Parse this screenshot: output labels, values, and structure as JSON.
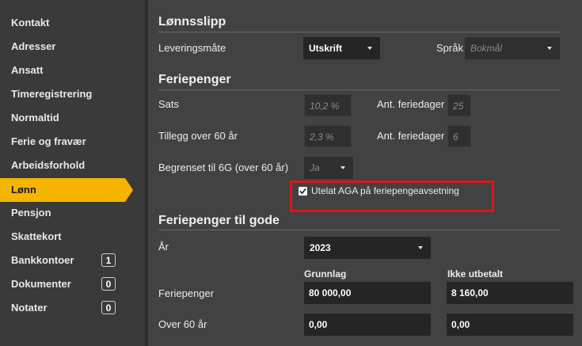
{
  "sidebar": {
    "items": [
      {
        "label": "Kontakt"
      },
      {
        "label": "Adresser"
      },
      {
        "label": "Ansatt"
      },
      {
        "label": "Timeregistrering"
      },
      {
        "label": "Normaltid"
      },
      {
        "label": "Ferie og fravær"
      },
      {
        "label": "Arbeidsforhold"
      },
      {
        "label": "Lønn",
        "active": true
      },
      {
        "label": "Pensjon"
      },
      {
        "label": "Skattekort"
      },
      {
        "label": "Bankkontoer",
        "badge": "1"
      },
      {
        "label": "Dokumenter",
        "badge": "0"
      },
      {
        "label": "Notater",
        "badge": "0"
      }
    ]
  },
  "lonnsslipp": {
    "title": "Lønnsslipp",
    "leveringsmate_label": "Leveringsmåte",
    "leveringsmate_value": "Utskrift",
    "sprak_label": "Språk",
    "sprak_value": "Bokmål"
  },
  "feriepenger": {
    "title": "Feriepenger",
    "sats_label": "Sats",
    "sats_value": "10,2 %",
    "ant_feriedager_label": "Ant. feriedager",
    "ant_feriedager_value": "25",
    "tillegg_label": "Tillegg over 60 år",
    "tillegg_value": "2,3 %",
    "ant_feriedager2_label": "Ant. feriedager",
    "ant_feriedager2_value": "6",
    "begrenset_label": "Begrenset til 6G (over 60 år)",
    "begrenset_value": "Ja",
    "checkbox_label": "Utelat AGA på feriepengeavsetning",
    "checkbox_checked": true
  },
  "til_gode": {
    "title": "Feriepenger til gode",
    "ar_label": "År",
    "ar_value": "2023",
    "grunnlag_header": "Grunnlag",
    "ikke_utbetalt_header": "Ikke utbetalt",
    "feriepenger_label": "Feriepenger",
    "feriepenger_grunnlag": "80 000,00",
    "feriepenger_ikke_utbetalt": "8 160,00",
    "over60_label": "Over 60 år",
    "over60_grunnlag": "0,00",
    "over60_ikke_utbetalt": "0,00"
  },
  "colors": {
    "accent": "#f5b400",
    "highlight": "#e0141b",
    "background": "#424242",
    "sidebar": "#3a3a3a"
  }
}
